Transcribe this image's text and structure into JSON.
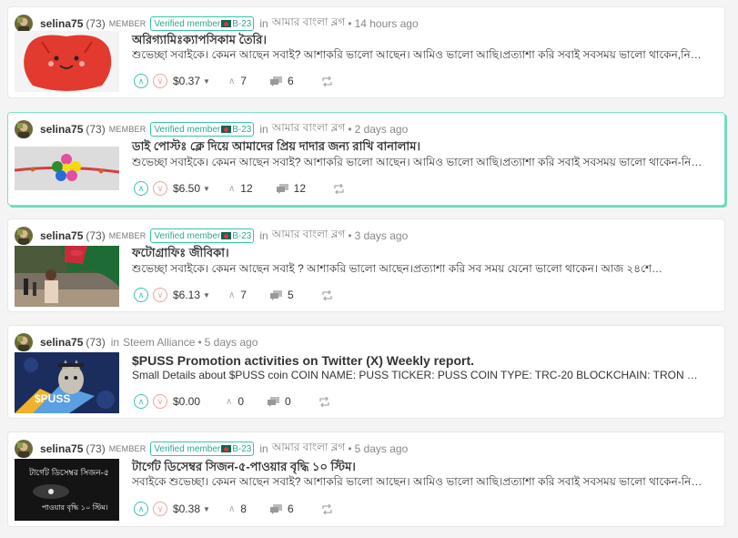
{
  "posts": [
    {
      "author": "selina75",
      "reputation": "(73)",
      "role": "MEMBER",
      "badge_label": "Verified member",
      "badge_code": "B-23",
      "in_label": "in",
      "community": "আমার বাংলা ব্লগ",
      "time": "14 hours ago",
      "title": "অরিগ্যামিঃক্যাপসিকাম তৈরি।",
      "body": "শুভেচ্ছা সবাইকে। কেমন আছেন সবাই? আশাকরি ভালো আছেন। আমিও ভালো আছি।প্রত্যাশা করি সবাই সবসময় ভালো থাকেন,নিরাপদে…",
      "payout": "$0.37",
      "votes": "7",
      "comments": "6"
    },
    {
      "author": "selina75",
      "reputation": "(73)",
      "role": "MEMBER",
      "badge_label": "Verified member",
      "badge_code": "B-23",
      "in_label": "in",
      "community": "আমার বাংলা ব্লগ",
      "time": "2 days ago",
      "title": "ডাই পোস্টঃ ক্লে দিয়ে আমাদের প্রিয় দাদার জন্য রাখি বানালাম।",
      "body": "শুভেচ্ছা সবাইকে। কেমন আছেন সবাই? আশাকরি ভালো আছেন। আমিও ভালো আছি।প্রত্যাশা করি সবাই সবসময় ভালো থাকেন-নিরাপদে…",
      "payout": "$6.50",
      "votes": "12",
      "comments": "12"
    },
    {
      "author": "selina75",
      "reputation": "(73)",
      "role": "MEMBER",
      "badge_label": "Verified member",
      "badge_code": "B-23",
      "in_label": "in",
      "community": "আমার বাংলা ব্লগ",
      "time": "3 days ago",
      "title": "ফটোগ্রাফিঃ জীবিকা।",
      "body": "শুভেচ্ছা সবাইকে। কেমন আছেন সবাই ? আশাকরি ভালো আছেন।প্রত্যাশা করি সব সময় যেনো ভালো থাকেন। আজ ২৪শে…",
      "payout": "$6.13",
      "votes": "7",
      "comments": "5"
    },
    {
      "author": "selina75",
      "reputation": "(73)",
      "in_label": "in",
      "community": "Steem Alliance",
      "time": "5 days ago",
      "title": "$PUSS Promotion activities on Twitter (X) Weekly report.",
      "body": "Small Details about $PUSS coin COIN NAME: PUSS TICKER: PUSS COIN TYPE: TRC-20 BLOCKCHAIN: TRON TOTAL SUPPL…",
      "thumb_text": "$PUSS",
      "payout": "$0.00",
      "votes": "0",
      "comments": "0"
    },
    {
      "author": "selina75",
      "reputation": "(73)",
      "role": "MEMBER",
      "badge_label": "Verified member",
      "badge_code": "B-23",
      "in_label": "in",
      "community": "আমার বাংলা ব্লগ",
      "time": "5 days ago",
      "title": "টার্গেট ডিসেম্বর সিজন-৫-পাওয়ার বৃদ্ধি ১০ স্টিম।",
      "body": "সবাইকে শুভেচ্ছা। কেমন আছেন সবাই? আশাকরি ভালো আছেন। আমিও ভালো আছি।প্রত্যাশা করি সবাই সবসময় ভালো থাকেন-নিরাপদে…",
      "thumb_line1": "টার্গেট ডিসেম্বর সিজন-৫",
      "thumb_line2": "পাওয়ার বৃদ্ধি ১০ স্টিম।",
      "payout": "$0.38",
      "votes": "8",
      "comments": "6"
    }
  ],
  "colors": {
    "accent": "#37c4a8",
    "downvote": "#f2a0a0",
    "highlight_border": "#6fd9bd"
  },
  "icons": [
    "upvote-icon",
    "downvote-icon",
    "caret-down-icon",
    "votes-chevron-icon",
    "comments-icon",
    "reblog-icon",
    "bangladesh-flag-icon"
  ]
}
